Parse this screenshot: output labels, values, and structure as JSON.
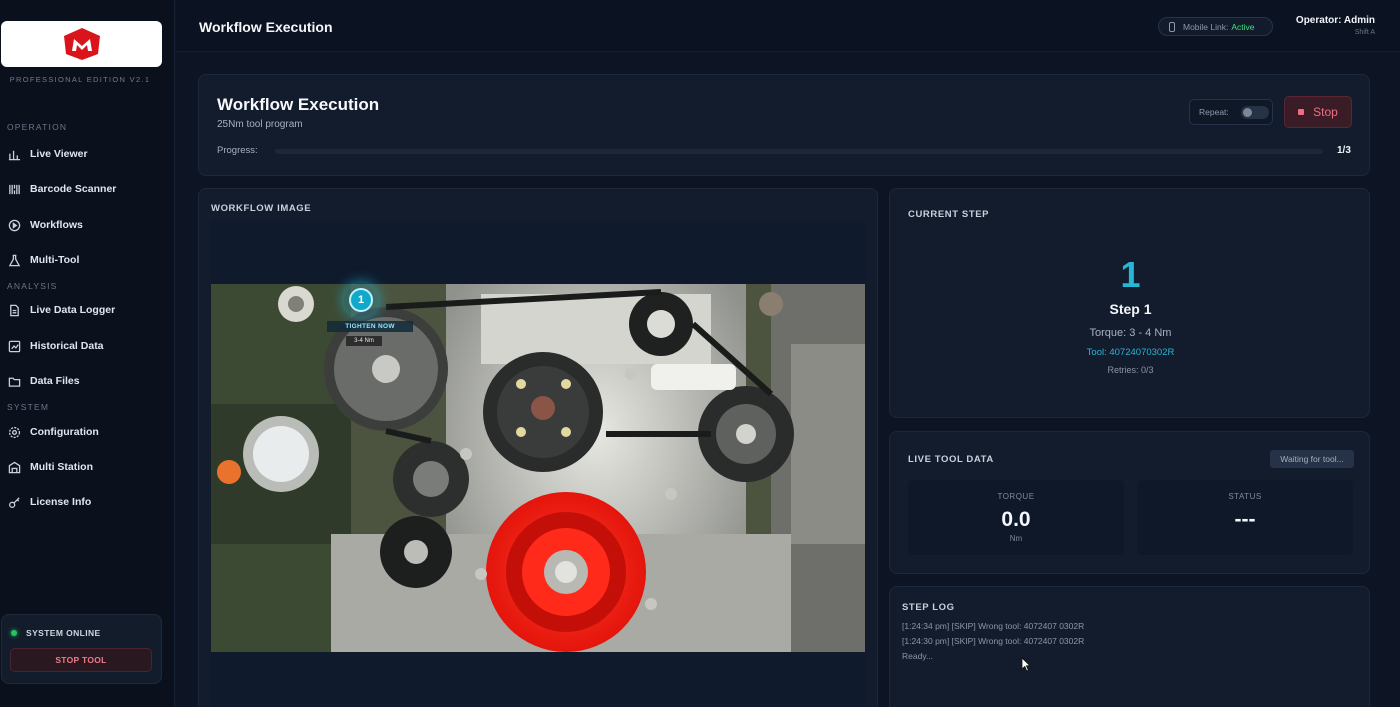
{
  "sidebar": {
    "edition": "PROFESSIONAL EDITION V2.1",
    "sections": {
      "operation": "OPERATION",
      "analysis": "ANALYSIS",
      "system": "SYSTEM"
    },
    "items": [
      {
        "label": "Live Viewer",
        "icon": "bar-chart-icon"
      },
      {
        "label": "Barcode Scanner",
        "icon": "barcode-icon"
      },
      {
        "label": "Workflows",
        "icon": "play-circle-icon"
      },
      {
        "label": "Multi-Tool",
        "icon": "flask-icon"
      },
      {
        "label": "Live Data Logger",
        "icon": "document-icon"
      },
      {
        "label": "Historical Data",
        "icon": "chart-box-icon"
      },
      {
        "label": "Data Files",
        "icon": "folder-icon"
      },
      {
        "label": "Configuration",
        "icon": "gear-icon"
      },
      {
        "label": "Multi Station",
        "icon": "station-icon"
      },
      {
        "label": "License Info",
        "icon": "key-icon"
      }
    ],
    "system_status": "SYSTEM ONLINE",
    "stop_tool_label": "STOP TOOL"
  },
  "header": {
    "title": "Workflow Execution",
    "mobile_link_label": "Mobile Link:",
    "mobile_link_status": "Active",
    "operator": "Operator: Admin",
    "shift": "Shift A"
  },
  "execution": {
    "title": "Workflow Execution",
    "subtitle": "25Nm tool program",
    "repeat_label": "Repeat:",
    "stop_label": "Stop",
    "progress_label": "Progress:",
    "progress_fraction": 0,
    "progress_count": "1/3"
  },
  "workflow_image": {
    "label": "WORKFLOW IMAGE",
    "marker_number": "1",
    "marker_action": "TIGHTEN NOW",
    "marker_torque": "3-4 Nm"
  },
  "current_step": {
    "label": "CURRENT STEP",
    "number": "1",
    "name": "Step 1",
    "torque": "Torque: 3 - 4 Nm",
    "tool": "Tool: 40724070302R",
    "retries": "Retries: 0/3"
  },
  "live_tool": {
    "label": "LIVE TOOL DATA",
    "waiting": "Waiting for tool...",
    "torque_label": "TORQUE",
    "torque_value": "0.0",
    "torque_unit": "Nm",
    "status_label": "STATUS",
    "status_value": "---"
  },
  "step_log": {
    "label": "STEP LOG",
    "lines": [
      "[1:24:34 pm] [SKIP] Wrong tool: 4072407 0302R",
      "[1:24:30 pm] [SKIP] Wrong tool: 4072407 0302R",
      "Ready..."
    ]
  },
  "colors": {
    "accent": "#22b8d6",
    "danger": "#f26d83",
    "online": "#22c55e",
    "highlight_part": "#ff2a1a"
  }
}
